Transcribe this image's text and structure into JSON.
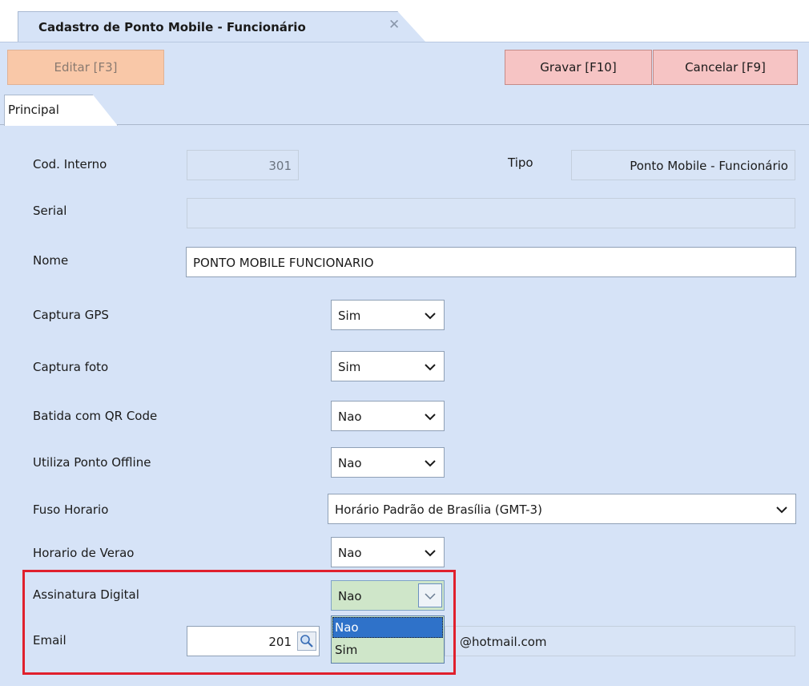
{
  "window": {
    "tab_title": "Cadastro de Ponto Mobile - Funcionário",
    "close_glyph": "✕"
  },
  "toolbar": {
    "edit_label": "Editar [F3]",
    "save_label": "Gravar [F10]",
    "cancel_label": "Cancelar [F9]"
  },
  "page_tab": {
    "label": "Principal"
  },
  "form": {
    "cod_interno": {
      "label": "Cod. Interno",
      "value": "301"
    },
    "tipo": {
      "label": "Tipo",
      "value": "Ponto Mobile - Funcionário"
    },
    "serial": {
      "label": "Serial",
      "value": ""
    },
    "nome": {
      "label": "Nome",
      "value": "PONTO MOBILE FUNCIONARIO"
    },
    "captura_gps": {
      "label": "Captura GPS",
      "value": "Sim"
    },
    "captura_foto": {
      "label": "Captura foto",
      "value": "Sim"
    },
    "batida_qr": {
      "label": "Batida com QR Code",
      "value": "Nao"
    },
    "ponto_offline": {
      "label": "Utiliza Ponto Offline",
      "value": "Nao"
    },
    "fuso_horario": {
      "label": "Fuso Horario",
      "value": "Horário Padrão de Brasília (GMT-3)"
    },
    "horario_verao": {
      "label": "Horario de Verao",
      "value": "Nao"
    },
    "assinatura_digital": {
      "label": "Assinatura Digital",
      "value": "Nao",
      "options": [
        "Nao",
        "Sim"
      ],
      "selected_option": "Nao"
    },
    "email": {
      "label": "Email",
      "code": "201",
      "address": "@hotmail.com"
    }
  },
  "colors": {
    "background": "#d6e3f7",
    "button_red": "#f6c4c4",
    "button_edit": "#f9c8a8",
    "dropdown_green": "#cfe6c9",
    "dropdown_highlight": "#2f72c9",
    "highlight_border": "#e0202d"
  },
  "icons": {
    "close": "close-icon",
    "chevron": "chevron-down-icon",
    "lookup": "search-lookup-icon"
  }
}
